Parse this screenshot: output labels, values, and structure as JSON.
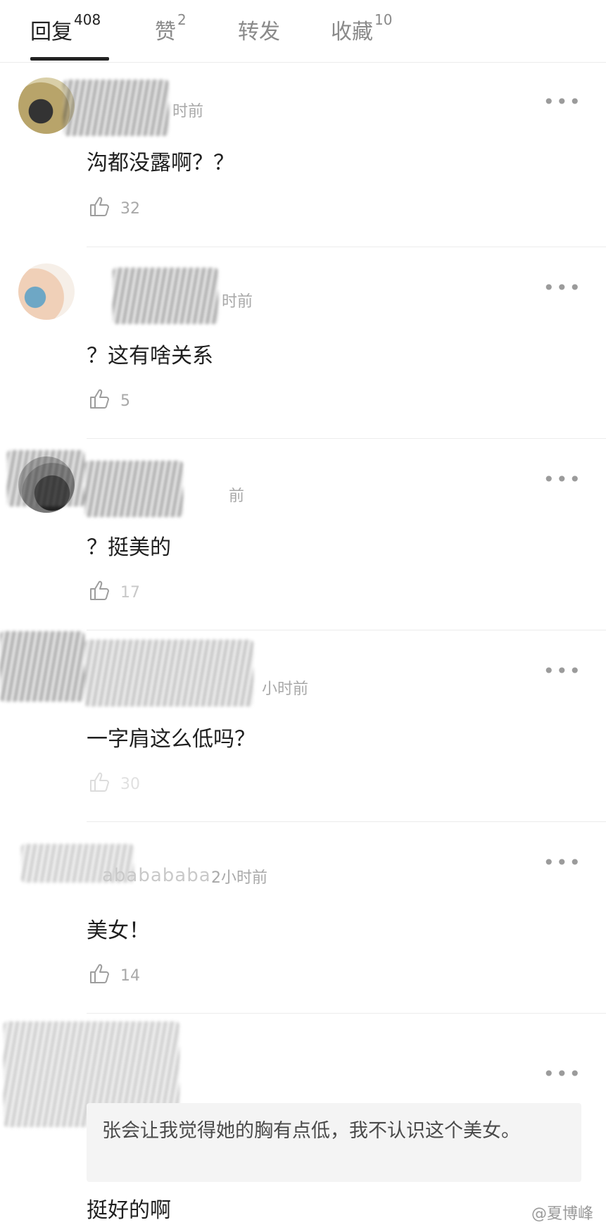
{
  "tabs": [
    {
      "label": "回复",
      "count": "408"
    },
    {
      "label": "赞",
      "count": "2"
    },
    {
      "label": "转发",
      "count": ""
    },
    {
      "label": "收藏",
      "count": "10"
    }
  ],
  "comments": [
    {
      "time": "时前",
      "text": "沟都没露啊？？",
      "likes": "32"
    },
    {
      "time": "时前",
      "text": "？这有啥关系",
      "likes": "5"
    },
    {
      "time": "前",
      "text": "？挺美的",
      "likes": "17"
    },
    {
      "time": "小时前",
      "text": "一字肩这么低吗？",
      "likes": "30"
    },
    {
      "username": "ababababa",
      "time": "2小时前",
      "text": "美女！",
      "likes": "14"
    },
    {
      "quote": "张会让我觉得她的胸有点低，我不认识这个美女。",
      "text": "挺好的啊"
    }
  ],
  "more_label": "•••",
  "watermark": "@夏博峰"
}
